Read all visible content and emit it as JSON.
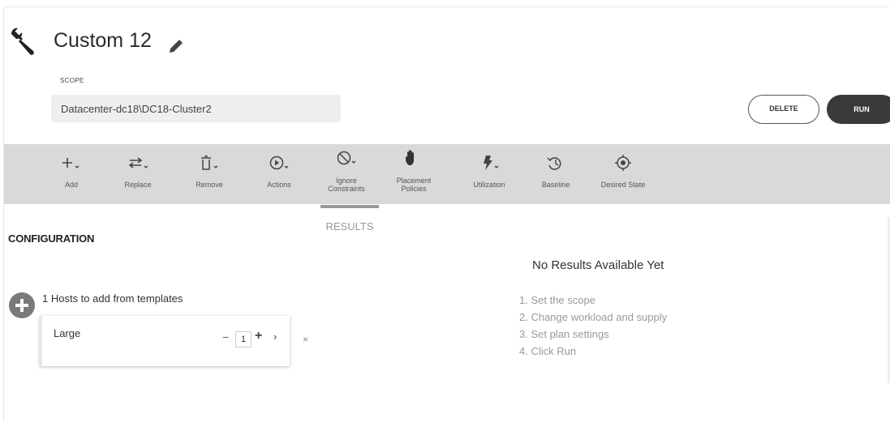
{
  "header": {
    "title": "Custom 12",
    "icon": "wrench-icon",
    "edit_icon": "pencil-icon"
  },
  "scope": {
    "label": "SCOPE",
    "value": "Datacenter-dc18\\DC18-Cluster2"
  },
  "buttons": {
    "delete": "DELETE",
    "run": "RUN"
  },
  "toolbar": {
    "items": [
      {
        "label": "Add",
        "icon": "plus-dropdown-icon"
      },
      {
        "label": "Replace",
        "icon": "replace-arrows-icon"
      },
      {
        "label": "Remove",
        "icon": "trash-dropdown-icon"
      },
      {
        "label": "Actions",
        "icon": "play-circle-dropdown-icon"
      },
      {
        "label": "Ignore Constraints",
        "icon": "ban-dropdown-icon"
      },
      {
        "label": "Placement Policies",
        "icon": "hand-icon"
      },
      {
        "label": "Utilization",
        "icon": "bolt-dropdown-icon"
      },
      {
        "label": "Baseline",
        "icon": "history-icon"
      },
      {
        "label": "Desired State",
        "icon": "target-icon"
      }
    ]
  },
  "tabs": {
    "results": "RESULTS"
  },
  "configuration": {
    "title": "CONFIGURATION",
    "hosts_text": "1 Hosts to add from templates",
    "template": {
      "name": "Large",
      "quantity": "1",
      "minus": "−",
      "plus": "+",
      "arrow": "›",
      "remove": "×"
    }
  },
  "results": {
    "title": "No Results Available Yet",
    "steps": [
      "1. Set the scope",
      "2. Change workload and supply",
      "3. Set plan settings",
      "4. Click Run"
    ]
  }
}
